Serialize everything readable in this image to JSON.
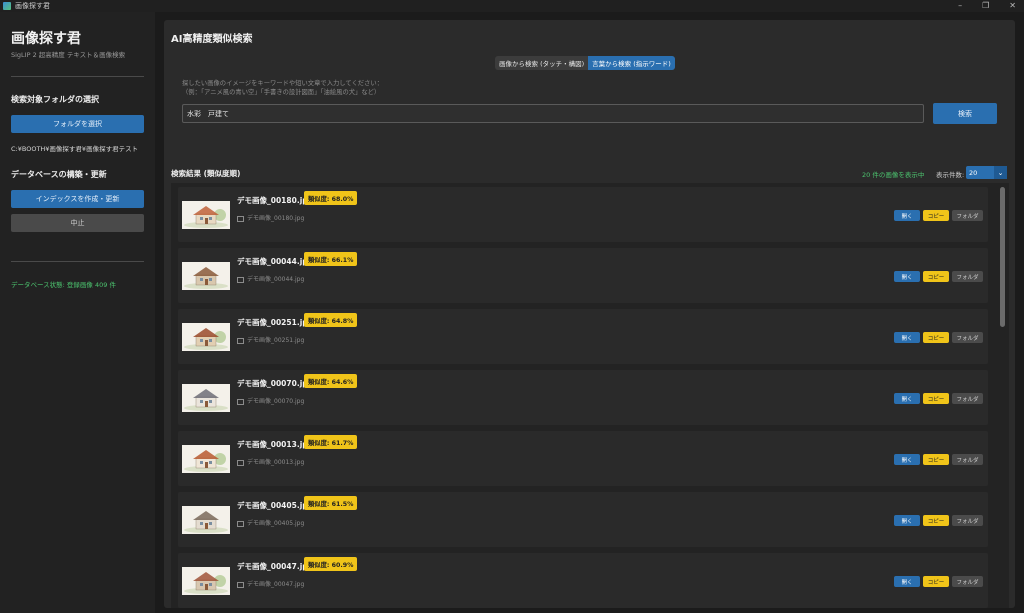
{
  "window": {
    "title": "画像探す君"
  },
  "sidebar": {
    "title": "画像探す君",
    "subtitle": "SigLIP 2 超高精度 テキスト＆画像検索",
    "folder_heading": "検索対象フォルダの選択",
    "folder_button": "フォルダを選択",
    "folder_path": "C:¥BOOTH¥画像探す君¥画像探す君テスト",
    "db_heading": "データベースの構築・更新",
    "index_button": "インデックスを作成・更新",
    "stop_button": "中止",
    "db_status": "データベース状態: 登録画像 409 件"
  },
  "main": {
    "title": "AI高精度類似検索",
    "mode_tabs": [
      {
        "label": "画像から検索 (タッチ・構図)",
        "active": false
      },
      {
        "label": "言葉から検索 (指示ワード)",
        "active": true
      }
    ],
    "hint_line1": "探したい画像のイメージをキーワードや短い文章で入力してください：",
    "hint_line2": "（例：「アニメ風の青い空」「手書きの設計図面」「油絵風の犬」など）",
    "query_value": "水彩　戸建て",
    "search_button": "検索",
    "results_heading": "検索結果 (類似度順)",
    "results_count": "20 件の画像を表示中",
    "display_count_label": "表示件数:",
    "display_count_value": "20",
    "action_labels": {
      "open": "開く",
      "copy": "コピー",
      "folder": "フォルダ"
    }
  },
  "results": [
    {
      "filename": "デモ画像_00180.jpg",
      "similarity": "類似度: 68.0%",
      "path": "デモ画像_00180.jpg"
    },
    {
      "filename": "デモ画像_00044.jpg",
      "similarity": "類似度: 66.1%",
      "path": "デモ画像_00044.jpg"
    },
    {
      "filename": "デモ画像_00251.jpg",
      "similarity": "類似度: 64.8%",
      "path": "デモ画像_00251.jpg"
    },
    {
      "filename": "デモ画像_00070.jpg",
      "similarity": "類似度: 64.6%",
      "path": "デモ画像_00070.jpg"
    },
    {
      "filename": "デモ画像_00013.jpg",
      "similarity": "類似度: 61.7%",
      "path": "デモ画像_00013.jpg"
    },
    {
      "filename": "デモ画像_00405.jpg",
      "similarity": "類似度: 61.5%",
      "path": "デモ画像_00405.jpg"
    },
    {
      "filename": "デモ画像_00047.jpg",
      "similarity": "類似度: 60.9%",
      "path": "デモ画像_00047.jpg"
    }
  ],
  "colors": {
    "accent_blue": "#2a6fb0",
    "badge_yellow": "#f0c419",
    "status_green": "#4cc46f"
  }
}
